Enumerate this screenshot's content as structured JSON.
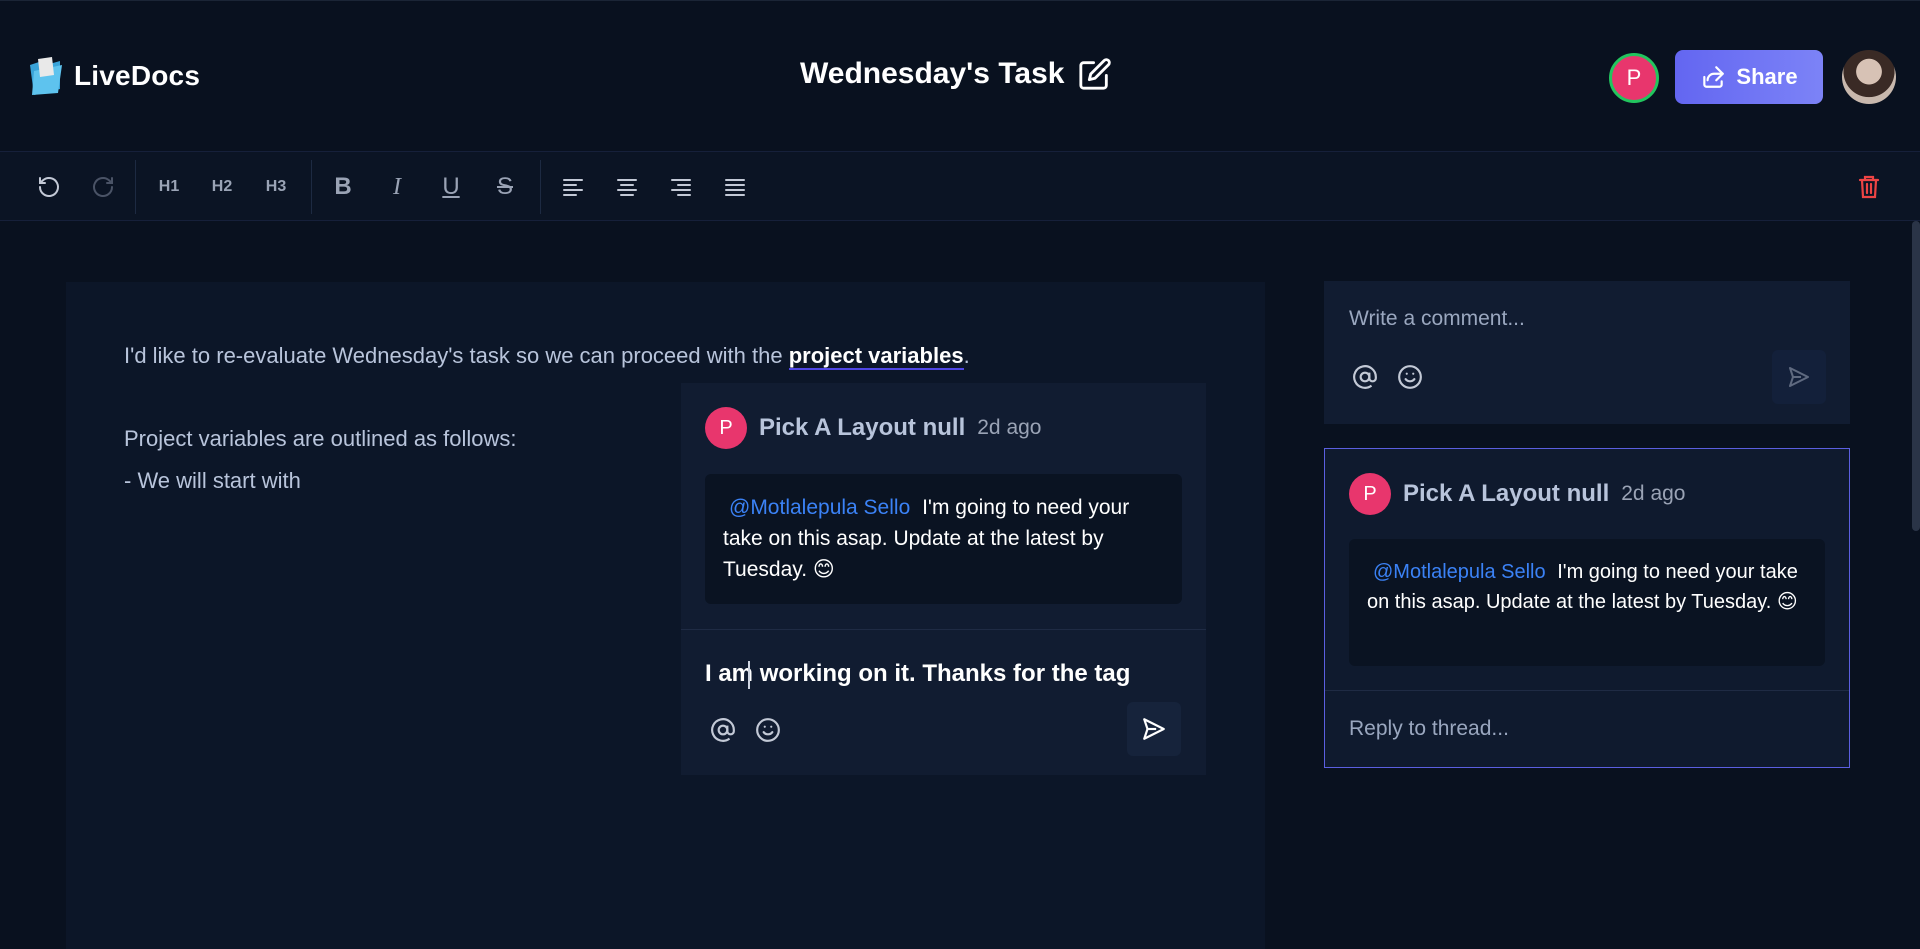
{
  "app": {
    "name": "LiveDocs",
    "document_title": "Wednesday's Task",
    "share_label": "Share",
    "collaborator_initial": "P"
  },
  "toolbar": {
    "h1": "H1",
    "h2": "H2",
    "h3": "H3",
    "bold": "B",
    "italic": "I",
    "underline": "U",
    "strike": "S"
  },
  "editor": {
    "line1_before": "I'd like to re-evaluate Wednesday's task so we can proceed with the ",
    "line1_highlight": "project variables",
    "line1_after": ".",
    "line2": "Project variables are outlined as follows:",
    "line3": "- We will start with"
  },
  "floating_comment": {
    "initial": "P",
    "author": "Pick A Layout null",
    "time": "2d ago",
    "mention": "@Motlalepula Sello",
    "text": "I'm going to need your take on this asap. Update at the latest by Tuesday. 😊",
    "reply_value": "I am working on it. Thanks for the tag"
  },
  "composer": {
    "placeholder": "Write a comment..."
  },
  "thread": {
    "initial": "P",
    "author": "Pick A Layout null",
    "time": "2d ago",
    "mention": "@Motlalepula Sello",
    "text": "I'm going to need your take on this asap. Update at the latest by Tuesday. 😊",
    "reply_placeholder": "Reply to thread..."
  },
  "colors": {
    "background": "#09111f",
    "accent": "#6366f1",
    "avatar": "#e8366d",
    "mention": "#3b82f6",
    "delete": "#ef4444",
    "presence": "#22c55e"
  },
  "icons": {
    "logo": "folder-icon",
    "title_edit": "edit-icon",
    "share": "share-icon",
    "undo": "undo-icon",
    "redo": "redo-icon",
    "align_left": "align-left-icon",
    "align_center": "align-center-icon",
    "align_right": "align-right-icon",
    "align_justify": "align-justify-icon",
    "delete": "trash-icon",
    "mention": "at-sign-icon",
    "emoji": "smile-icon",
    "send": "send-icon"
  }
}
